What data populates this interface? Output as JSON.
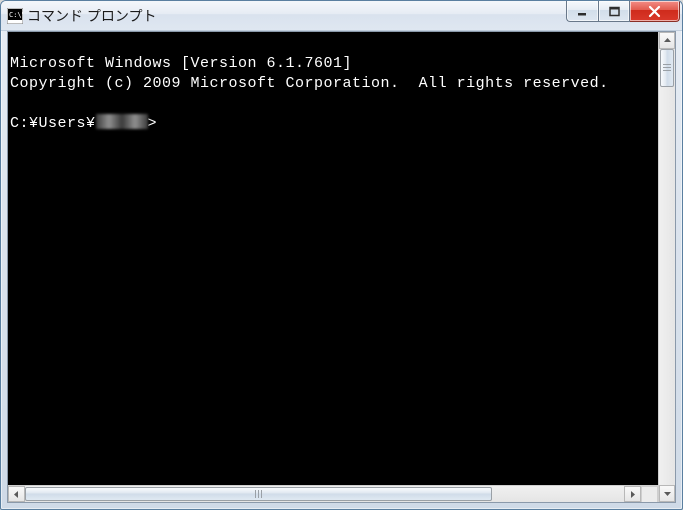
{
  "window": {
    "title": "コマンド プロンプト"
  },
  "console": {
    "line1": "Microsoft Windows [Version 6.1.7601]",
    "line2": "Copyright (c) 2009 Microsoft Corporation.  All rights reserved.",
    "blank": "",
    "prompt_prefix": "C:¥Users¥",
    "prompt_suffix": ">"
  }
}
